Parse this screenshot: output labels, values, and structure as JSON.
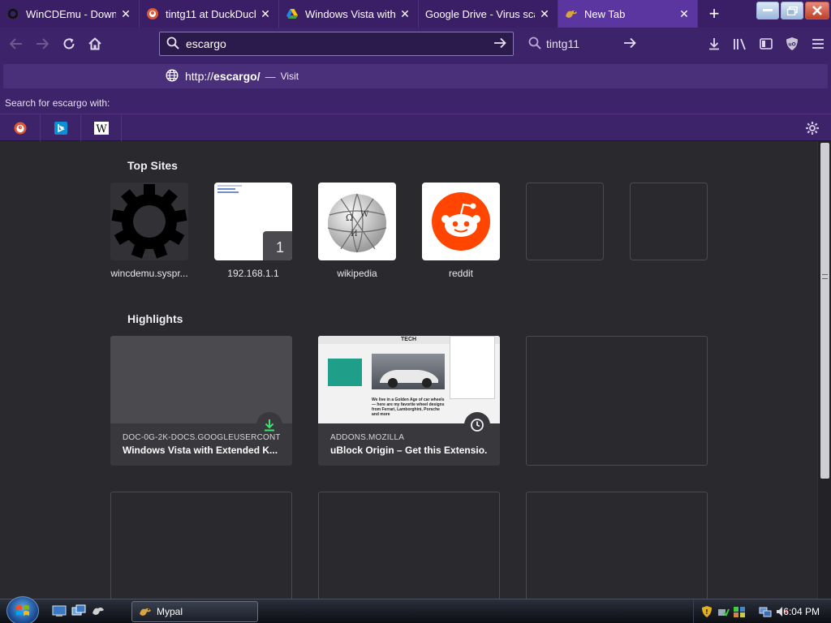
{
  "tabs": [
    {
      "title": "WinCDEmu - Downl",
      "favicon": "gear-icon",
      "active": false
    },
    {
      "title": "tintg11 at DuckDuck",
      "favicon": "duckduckgo-icon",
      "active": false
    },
    {
      "title": "Windows Vista with E",
      "favicon": "google-drive-icon",
      "active": false
    },
    {
      "title": "Google Drive - Virus scan",
      "favicon": "none",
      "active": false
    },
    {
      "title": "New Tab",
      "favicon": "mypal-icon",
      "active": true
    }
  ],
  "toolbar": {
    "url_value": "escargo",
    "search_value": "tintg11"
  },
  "dropdown": {
    "url_prefix": "http://",
    "url_bold": "escargo/",
    "separator": "—",
    "action": "Visit",
    "search_with_label": "Search for escargo with:"
  },
  "top_sites": {
    "heading": "Top Sites",
    "items": [
      {
        "label": "wincdemu.syspr...",
        "kind": "gear"
      },
      {
        "label": "192.168.1.1",
        "kind": "page",
        "badge": "1"
      },
      {
        "label": "wikipedia",
        "kind": "wikipedia"
      },
      {
        "label": "reddit",
        "kind": "reddit"
      }
    ]
  },
  "highlights": {
    "heading": "Highlights",
    "items": [
      {
        "source": "DOC-0G-2K-DOCS.GOOGLEUSERCONTEN...",
        "title": "Windows Vista with Extended K...",
        "badge_icon": "download-icon"
      },
      {
        "source": "ADDONS.MOZILLA",
        "title": "uBlock Origin – Get this Extensio...",
        "badge_icon": "clock-icon",
        "thumb_text": "TECH",
        "thumb_caption": "We live in a Golden Age of car wheels — here are my favorite wheel designs from Ferrari, Lamborghini, Porsche and more"
      }
    ]
  },
  "taskbar": {
    "app_label": "Mypal",
    "clock": "6:04 PM"
  },
  "colors": {
    "chrome_purple": "#3b1f66",
    "active_tab": "#5b35a0",
    "content_bg": "#2a2a2e",
    "reddit_orange": "#ff4500"
  }
}
